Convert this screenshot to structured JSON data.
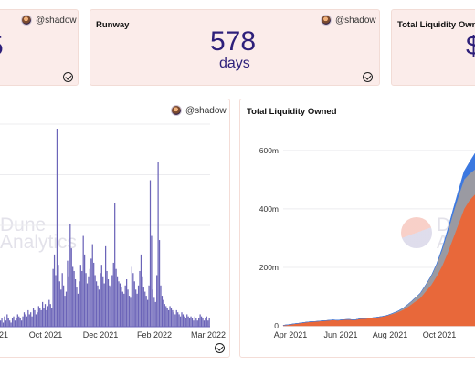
{
  "cards": {
    "left_counter": {
      "value_fragment": "5",
      "author": "@shadow"
    },
    "runway": {
      "title": "Runway",
      "value": "578",
      "unit": "days",
      "author": "@shadow"
    },
    "total_liquidity_counter": {
      "title": "Total Liquidity Owne",
      "value_fragment": "$"
    },
    "left_chart": {
      "author": "@shadow",
      "watermark_line1": "Dune",
      "watermark_line2": "Analytics"
    },
    "liquidity_chart": {
      "title": "Total Liquidity Owned",
      "watermark_line1": "Dun",
      "watermark_line2": "Ana"
    }
  },
  "chart_data": [
    {
      "type": "bar",
      "title": "",
      "x_tick_labels": [
        "21",
        "Oct 2021",
        "Dec 2021",
        "Feb 2022",
        "Mar 2022"
      ],
      "series_color": "#6b64b8",
      "grid": true,
      "values": [
        3,
        4,
        2,
        5,
        3,
        6,
        4,
        3,
        2,
        4,
        5,
        3,
        4,
        6,
        5,
        4,
        3,
        5,
        7,
        6,
        5,
        8,
        6,
        7,
        5,
        9,
        8,
        6,
        7,
        10,
        9,
        8,
        12,
        9,
        11,
        8,
        10,
        13,
        11,
        9,
        28,
        35,
        25,
        96,
        30,
        22,
        18,
        26,
        20,
        15,
        17,
        32,
        24,
        50,
        38,
        29,
        27,
        23,
        19,
        16,
        22,
        30,
        27,
        44,
        35,
        26,
        21,
        24,
        28,
        33,
        40,
        31,
        25,
        22,
        20,
        18,
        26,
        30,
        24,
        21,
        39,
        27,
        23,
        20,
        19,
        25,
        31,
        60,
        28,
        24,
        22,
        21,
        19,
        17,
        16,
        20,
        23,
        18,
        15,
        14,
        29,
        26,
        22,
        18,
        16,
        20,
        27,
        35,
        24,
        19,
        17,
        15,
        13,
        20,
        71,
        44,
        18,
        14,
        12,
        25,
        80,
        42,
        20,
        15,
        13,
        11,
        10,
        9,
        8,
        10,
        9,
        8,
        7,
        6,
        8,
        7,
        6,
        5,
        7,
        6,
        5,
        4,
        6,
        5,
        4,
        5,
        4,
        3,
        5,
        4,
        3,
        4,
        6,
        5,
        4,
        3,
        4,
        5,
        3,
        4
      ]
    },
    {
      "type": "area",
      "title": "Total Liquidity Owned",
      "x_tick_labels": [
        "Apr 2021",
        "Jun 2021",
        "Aug 2021",
        "Oct 2021"
      ],
      "y_tick_labels": [
        "0",
        "200m",
        "400m",
        "600m"
      ],
      "ylim": [
        0,
        640000000
      ],
      "grid": true,
      "series": [
        {
          "color": "#e8683a",
          "values": [
            2000000.0,
            4000000.0,
            7000000.0,
            9000000.0,
            12000000.0,
            14000000.0,
            15000000.0,
            17000000.0,
            18000000.0,
            20000000.0,
            19000000.0,
            21000000.0,
            22000000.0,
            20000000.0,
            24000000.0,
            25000000.0,
            27000000.0,
            29000000.0,
            32000000.0,
            36000000.0,
            41000000.0,
            47000000.0,
            56000000.0,
            68000000.0,
            82000000.0,
            95000000.0,
            118000000.0,
            140000000.0,
            170000000.0,
            205000000.0,
            250000000.0,
            300000000.0,
            350000000.0,
            400000000.0,
            430000000.0,
            450000000.0
          ]
        },
        {
          "color": "#9a9aa2",
          "values": [
            0,
            0,
            0,
            0,
            0,
            0,
            0,
            0,
            0,
            0,
            0,
            0,
            0,
            0,
            0,
            0,
            0,
            0,
            0,
            0,
            2000000.0,
            4000000.0,
            6000000.0,
            9000000.0,
            12000000.0,
            16000000.0,
            22000000.0,
            30000000.0,
            40000000.0,
            55000000.0,
            70000000.0,
            85000000.0,
            95000000.0,
            100000000.0,
            90000000.0,
            85000000.0
          ]
        },
        {
          "color": "#3b78e0",
          "values": [
            0,
            0,
            0,
            0,
            0,
            0,
            0,
            0,
            0,
            0,
            0,
            0,
            0,
            0,
            0,
            0,
            0,
            0,
            0,
            0,
            0,
            0,
            0,
            0,
            0,
            0,
            0,
            0,
            2000000.0,
            5000000.0,
            8000000.0,
            12000000.0,
            18000000.0,
            28000000.0,
            40000000.0,
            55000000.0
          ]
        }
      ]
    }
  ]
}
